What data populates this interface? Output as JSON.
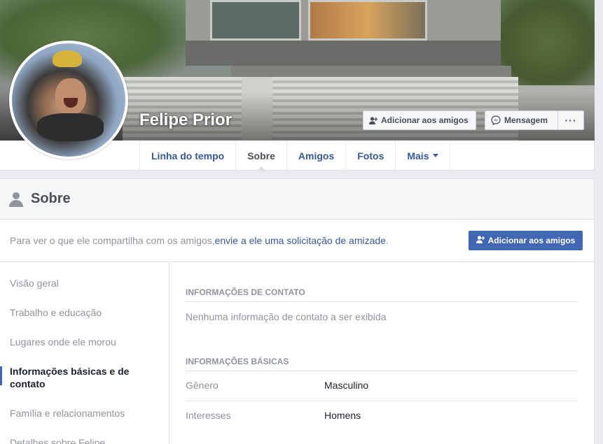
{
  "profile": {
    "name": "Felipe Prior",
    "add_friend_label": "Adicionar aos amigos",
    "message_label": "Mensagem",
    "more_label": "···"
  },
  "nav": {
    "tabs": [
      {
        "label": "Linha do tempo"
      },
      {
        "label": "Sobre"
      },
      {
        "label": "Amigos"
      },
      {
        "label": "Fotos"
      },
      {
        "label": "Mais"
      }
    ],
    "active_tab": "Sobre"
  },
  "about": {
    "title": "Sobre",
    "friend_prompt_text": "Para ver o que ele compartilha com os amigos, ",
    "friend_prompt_link": "envie a ele uma solicitação de amizade",
    "friend_prompt_end": ".",
    "add_friend_label": "Adicionar aos amigos",
    "menu": [
      {
        "label": "Visão geral"
      },
      {
        "label": "Trabalho e educação"
      },
      {
        "label": "Lugares onde ele morou"
      },
      {
        "label": "Informações básicas e de contato"
      },
      {
        "label": "Família e relacionamentos"
      },
      {
        "label": "Detalhes sobre Felipe"
      }
    ],
    "active_menu": "Informações básicas e de contato",
    "contact": {
      "heading": "INFORMAÇÕES DE CONTATO",
      "empty_text": "Nenhuma informação de contato a ser exibida"
    },
    "basic": {
      "heading": "INFORMAÇÕES BÁSICAS",
      "rows": [
        {
          "label": "Gênero",
          "value": "Masculino"
        },
        {
          "label": "Interesses",
          "value": "Homens"
        }
      ]
    }
  },
  "colors": {
    "brand_blue": "#4267b2",
    "link_blue": "#365899",
    "muted_gray": "#90949c",
    "page_bg": "#e9ebee"
  },
  "icons": [
    "add-friend-icon",
    "messenger-icon",
    "person-icon",
    "caret-down-icon"
  ]
}
